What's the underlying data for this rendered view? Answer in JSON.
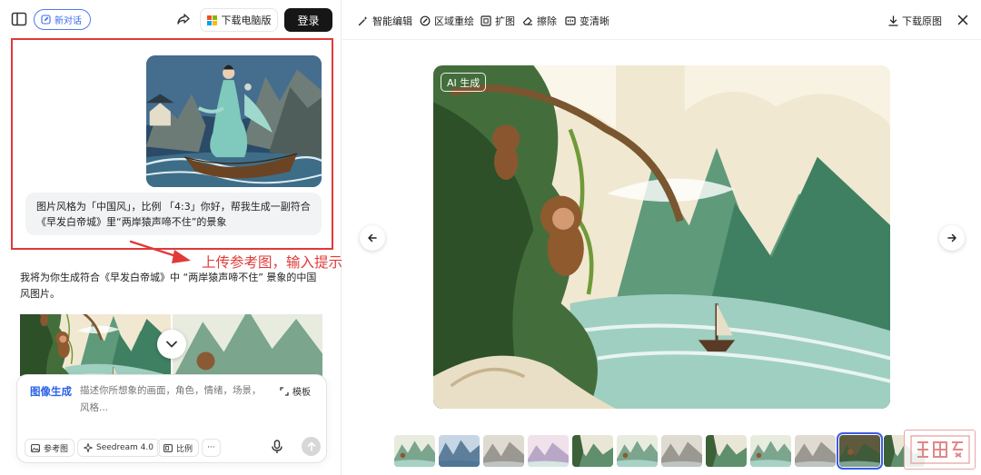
{
  "left_header": {
    "new_chat_label": "新对话",
    "download_pc_label": "下载电脑版",
    "login_label": "登录"
  },
  "user_message": {
    "text": "图片风格为「中国风」，比例 「4:3」你好，帮我生成一副符合《早发白帝城》里“两岸猿声啼不住”的景象"
  },
  "annotation": {
    "text": "上传参考图，输入提示词",
    "color": "#e03a3a"
  },
  "ai_message": {
    "text": "我将为你生成符合《早发白帝城》中 “两岸猿声啼不住” 景象的中国风图片。"
  },
  "composer": {
    "mode_label": "图像生成",
    "placeholder": "描述你所想象的画面，角色，情绪，场景，风格...",
    "template_label": "模板",
    "reference_label": "参考图",
    "model_label": "Seedream 4.0",
    "ratio_label": "比例",
    "more_label": "···"
  },
  "toolbar": {
    "smart_edit_label": "智能编辑",
    "region_redraw_label": "区域重绘",
    "expand_label": "扩图",
    "erase_label": "擦除",
    "sharpen_label": "变清晰",
    "download_original_label": "下载原图"
  },
  "main_image": {
    "badge": "AI 生成"
  },
  "thumbnails": {
    "count": 13,
    "active_index": 10
  },
  "colors": {
    "accent_blue": "#2c62e8",
    "annotation_red": "#e03a3a",
    "login_bg": "#161616"
  },
  "icons": [
    "sidebar-icon",
    "edit-icon",
    "share-icon",
    "windows-logo-icon",
    "image-icon",
    "spark-icon",
    "ratio-icon",
    "mic-icon",
    "send-icon",
    "magic-wand-icon",
    "region-redraw-icon",
    "expand-icon",
    "eraser-icon",
    "sharpen-icon",
    "download-icon",
    "close-icon",
    "chevron-down-icon",
    "arrow-left-icon",
    "arrow-right-icon",
    "resize-icon"
  ]
}
